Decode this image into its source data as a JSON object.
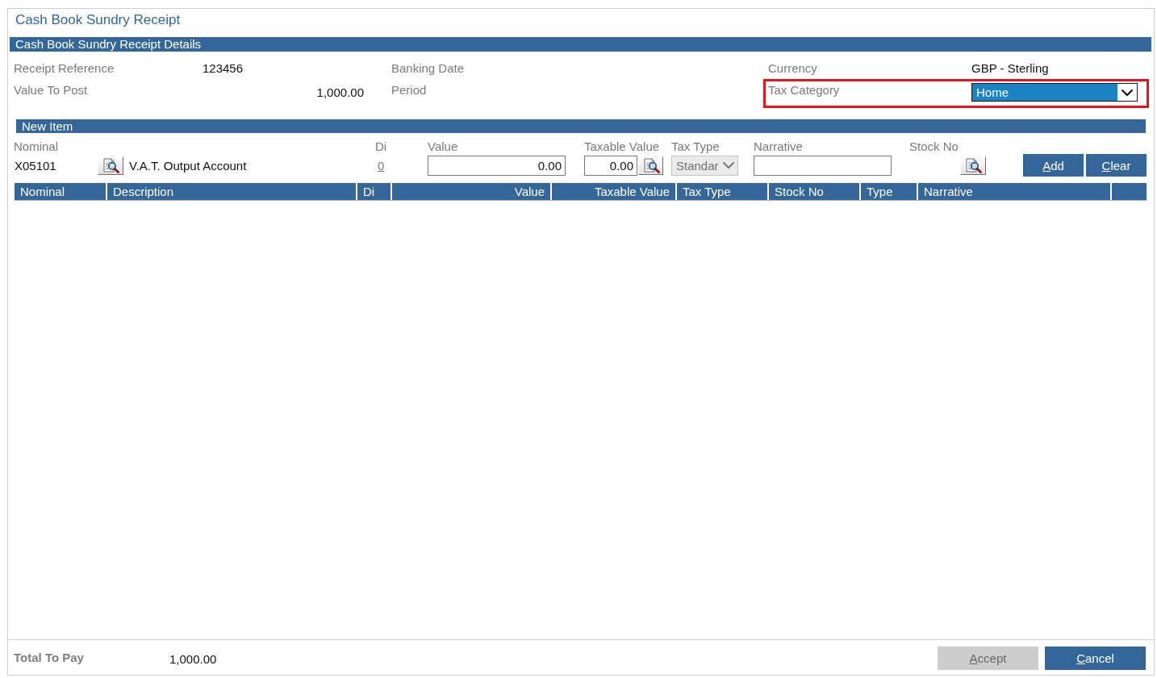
{
  "window": {
    "title": "Cash Book Sundry Receipt"
  },
  "details": {
    "heading": "Cash Book Sundry Receipt Details",
    "fields": [
      {
        "kind": "text",
        "label": "Receipt Reference",
        "value": "123456"
      },
      {
        "kind": "text",
        "label": "Banking Date"
      },
      {
        "kind": "text",
        "label": "Currency",
        "value": "GBP - Sterling"
      },
      {
        "kind": "amount",
        "label": "Value To Post",
        "value": "1,000.00"
      },
      {
        "kind": "text",
        "label": "Period"
      },
      {
        "kind": "select",
        "label": "Tax Category",
        "value": "Home",
        "focused": true,
        "highlighted": true
      }
    ]
  },
  "new_item": {
    "heading": "New Item",
    "fields": [
      {
        "kind": "nominal",
        "label": "Nominal",
        "code": "X05101",
        "description": "V.A.T. Output Account"
      },
      {
        "kind": "link",
        "label": "Di",
        "value": "0"
      },
      {
        "kind": "amount",
        "label": "Value",
        "value": "0.00"
      },
      {
        "kind": "amount_lookup",
        "label": "Taxable Value",
        "value": "0.00"
      },
      {
        "kind": "select",
        "label": "Tax Type",
        "value": "Standar",
        "disabled": true
      },
      {
        "kind": "text_input",
        "label": "Narrative"
      },
      {
        "kind": "lookup",
        "label": "Stock No"
      }
    ],
    "buttons": [
      {
        "label": "Add",
        "disabled": false,
        "access_key_underlined": true
      },
      {
        "label": "Clear",
        "disabled": false,
        "access_key_underlined": true
      }
    ]
  },
  "table": {
    "columns": [
      {
        "label": "Nominal",
        "kind": "text"
      },
      {
        "label": "Description",
        "kind": "text"
      },
      {
        "label": "Di",
        "kind": "text"
      },
      {
        "label": "Value",
        "kind": "number"
      },
      {
        "label": "Taxable Value",
        "kind": "number"
      },
      {
        "label": "Tax Type",
        "kind": "text"
      },
      {
        "label": "Stock No",
        "kind": "text"
      },
      {
        "label": "Type",
        "kind": "text"
      },
      {
        "label": "Narrative",
        "kind": "text"
      }
    ]
  },
  "footer": {
    "label": "Total To Pay",
    "value": "1,000.00",
    "buttons": [
      {
        "label": "Accept",
        "disabled": true,
        "access_key_underlined": true
      },
      {
        "label": "Cancel",
        "disabled": false,
        "access_key_underlined": true
      }
    ]
  }
}
